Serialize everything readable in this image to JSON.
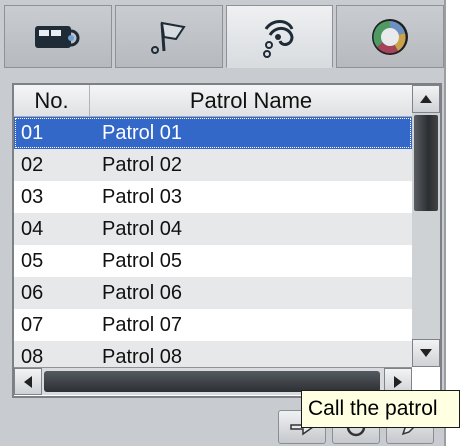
{
  "tabs": [
    {
      "name": "preset",
      "icon": "camera-preset-icon",
      "active": false
    },
    {
      "name": "flag",
      "icon": "flag-icon",
      "active": false
    },
    {
      "name": "patrol",
      "icon": "patrol-path-icon",
      "active": true
    },
    {
      "name": "pattern",
      "icon": "color-ball-icon",
      "active": false
    }
  ],
  "table": {
    "columns": [
      "No.",
      "Patrol Name"
    ],
    "rows": [
      {
        "no": "01",
        "name": "Patrol 01"
      },
      {
        "no": "02",
        "name": "Patrol 02"
      },
      {
        "no": "03",
        "name": "Patrol 03"
      },
      {
        "no": "04",
        "name": "Patrol 04"
      },
      {
        "no": "05",
        "name": "Patrol 05"
      },
      {
        "no": "06",
        "name": "Patrol 06"
      },
      {
        "no": "07",
        "name": "Patrol 07"
      },
      {
        "no": "08",
        "name": "Patrol 08"
      }
    ],
    "selected_index": 0
  },
  "toolbar": {
    "buttons": [
      {
        "name": "call-patrol-button",
        "icon": "arrow-right-icon"
      },
      {
        "name": "stop-patrol-button",
        "icon": "stop-icon"
      },
      {
        "name": "set-patrol-button",
        "icon": "pencil-icon"
      }
    ]
  },
  "tooltip": {
    "text": "Call the patrol"
  },
  "colors": {
    "selection": "#3468c8",
    "panel": "#c8cbcf",
    "tooltip_bg": "#ffffe1"
  }
}
